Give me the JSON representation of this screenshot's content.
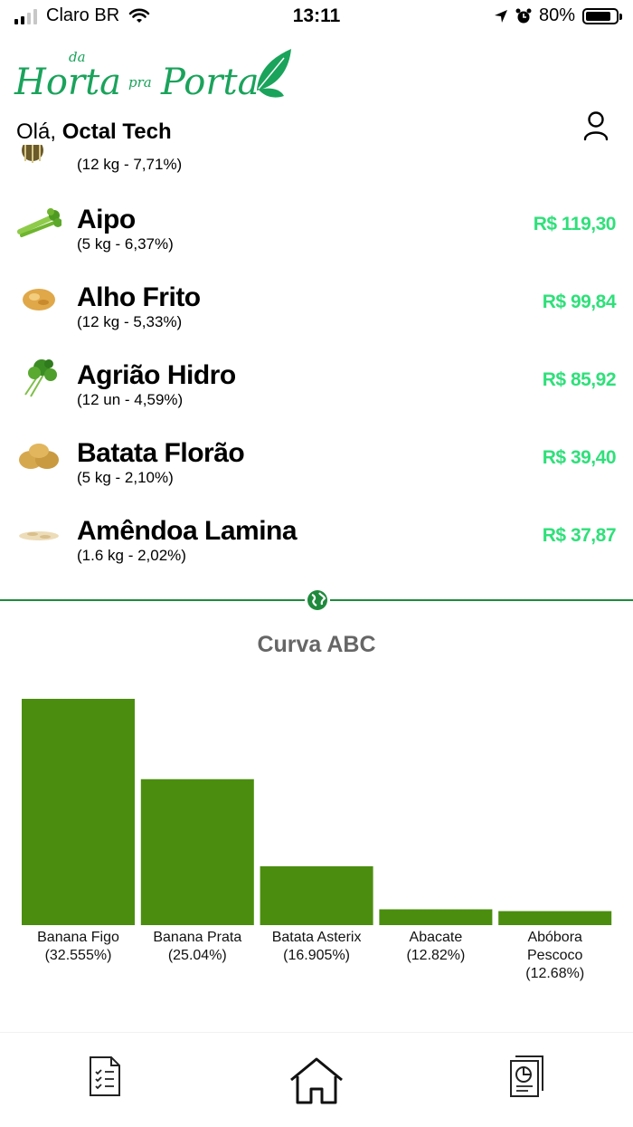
{
  "status_bar": {
    "carrier": "Claro BR",
    "time": "13:11",
    "battery": "80%"
  },
  "header": {
    "logo_text": "da Horta pra Porta",
    "greeting_prefix": "Olá,",
    "user_name": "Octal Tech"
  },
  "products": [
    {
      "name": "",
      "qty": "(12 kg - 7,71%)",
      "price": "",
      "icon": "melon-icon"
    },
    {
      "name": "Aipo",
      "qty": "(5 kg - 6,37%)",
      "price": "R$ 119,30",
      "icon": "celery-icon"
    },
    {
      "name": "Alho Frito",
      "qty": "(12 kg - 5,33%)",
      "price": "R$ 99,84",
      "icon": "fried-garlic-icon"
    },
    {
      "name": "Agrião Hidro",
      "qty": "(12 un - 4,59%)",
      "price": "R$ 85,92",
      "icon": "watercress-icon"
    },
    {
      "name": "Batata Florão",
      "qty": "(5 kg - 2,10%)",
      "price": "R$ 39,40",
      "icon": "potato-icon"
    },
    {
      "name": "Amêndoa Lamina",
      "qty": "(1.6 kg - 2,02%)",
      "price": "R$ 37,87",
      "icon": "almond-slices-icon"
    }
  ],
  "chart_title": "Curva ABC",
  "chart_data": {
    "type": "bar",
    "title": "Curva ABC",
    "categories": [
      "Banana Figo",
      "Banana Prata",
      "Batata Asterix",
      "Abacate",
      "Abóbora Pescoco"
    ],
    "category_lines": [
      [
        "Banana Figo"
      ],
      [
        "Banana Prata"
      ],
      [
        "Batata Asterix"
      ],
      [
        "Abacate"
      ],
      [
        "Abóbora",
        "Pescoco"
      ]
    ],
    "percent_labels": [
      "(32.555%)",
      "(25.04%)",
      "(16.905%)",
      "(12.82%)",
      "(12.68%)"
    ],
    "bar_heights_relative": [
      1.0,
      0.645,
      0.26,
      0.07,
      0.062
    ],
    "ylim": [
      0,
      1
    ],
    "grid": false,
    "color": "#4b8e0f"
  },
  "colors": {
    "brand_green": "#1aa35b",
    "price_green": "#2fe07a",
    "divider_green": "#1f8a3d",
    "bar_green": "#4b8e0f"
  },
  "nav": {
    "items": [
      {
        "icon": "checklist-icon"
      },
      {
        "icon": "home-icon"
      },
      {
        "icon": "report-chart-icon"
      }
    ]
  }
}
